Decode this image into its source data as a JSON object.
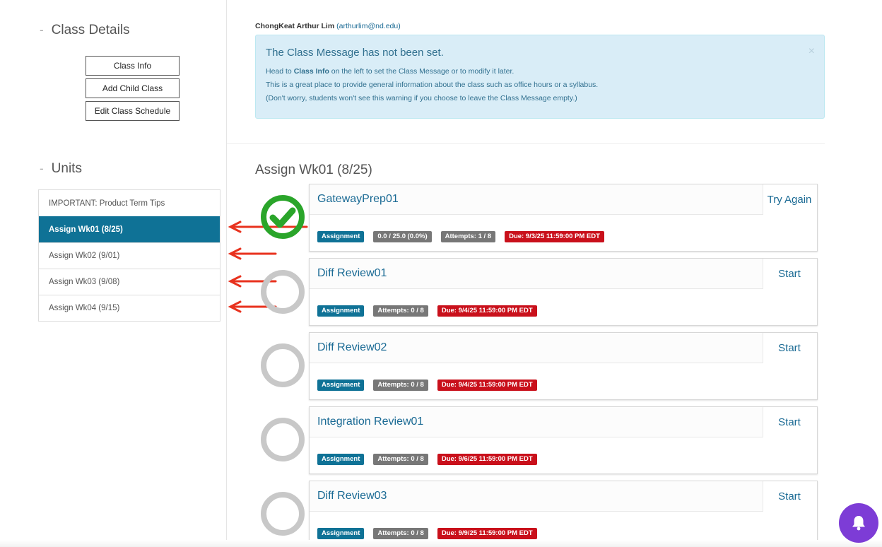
{
  "sidebar": {
    "class_details": {
      "dash": "-",
      "heading": "Class Details"
    },
    "buttons": [
      {
        "label": "Class Info"
      },
      {
        "label": "Add Child Class"
      },
      {
        "label": "Edit Class Schedule"
      }
    ],
    "units": {
      "dash": "-",
      "heading": "Units",
      "items": [
        {
          "label": "IMPORTANT: Product Term Tips",
          "active": false
        },
        {
          "label": "Assign Wk01 (8/25)",
          "active": true
        },
        {
          "label": "Assign Wk02 (9/01)",
          "active": false
        },
        {
          "label": "Assign Wk03 (9/08)",
          "active": false
        },
        {
          "label": "Assign Wk04 (9/15)",
          "active": false
        }
      ]
    }
  },
  "user": {
    "name": "ChongKeat Arthur Lim",
    "email": "(arthurlim@nd.edu)"
  },
  "alert": {
    "title": "The Class Message has not been set.",
    "line1_pre": "Head to ",
    "line1_bold": "Class Info",
    "line1_post": " on the left to set the Class Message or to modify it later.",
    "line2": "This is a great place to provide general information about the class such as office hours or a syllabus.",
    "line3": "(Don't worry, students won't see this warning if you choose to leave the Class Message empty.)",
    "close": "×"
  },
  "unit_title": "Assign Wk01 (8/25)",
  "assignments": [
    {
      "name": "GatewayPrep01",
      "action": "Try Again",
      "completed": true,
      "type": "Assignment",
      "score": "0.0 / 25.0 (0.0%)",
      "attempts": "Attempts: 1 / 8",
      "due": "Due: 9/3/25 11:59:00 PM EDT"
    },
    {
      "name": "Diff Review01",
      "action": "Start",
      "completed": false,
      "type": "Assignment",
      "attempts": "Attempts: 0 / 8",
      "due": "Due: 9/4/25 11:59:00 PM EDT"
    },
    {
      "name": "Diff Review02",
      "action": "Start",
      "completed": false,
      "type": "Assignment",
      "attempts": "Attempts: 0 / 8",
      "due": "Due: 9/4/25 11:59:00 PM EDT"
    },
    {
      "name": "Integration Review01",
      "action": "Start",
      "completed": false,
      "type": "Assignment",
      "attempts": "Attempts: 0 / 8",
      "due": "Due: 9/6/25 11:59:00 PM EDT"
    },
    {
      "name": "Diff Review03",
      "action": "Start",
      "completed": false,
      "type": "Assignment",
      "attempts": "Attempts: 0 / 8",
      "due": "Due: 9/9/25 11:59:00 PM EDT"
    }
  ],
  "colors": {
    "primary": "#0f7296",
    "link": "#1a6a94",
    "alert_bg": "#d9edf7",
    "badge_gray": "#777777",
    "badge_red": "#c9101b",
    "complete_green": "#2aa52a",
    "incomplete_gray": "#c8c8c8",
    "annotation_arrow": "#e8321e",
    "notification_bell_bg": "#7d3cd6"
  },
  "icons": {
    "status_complete": "green-check-circle-icon",
    "status_incomplete": "gray-ring-icon",
    "notification": "bell-icon",
    "close": "close-icon"
  }
}
